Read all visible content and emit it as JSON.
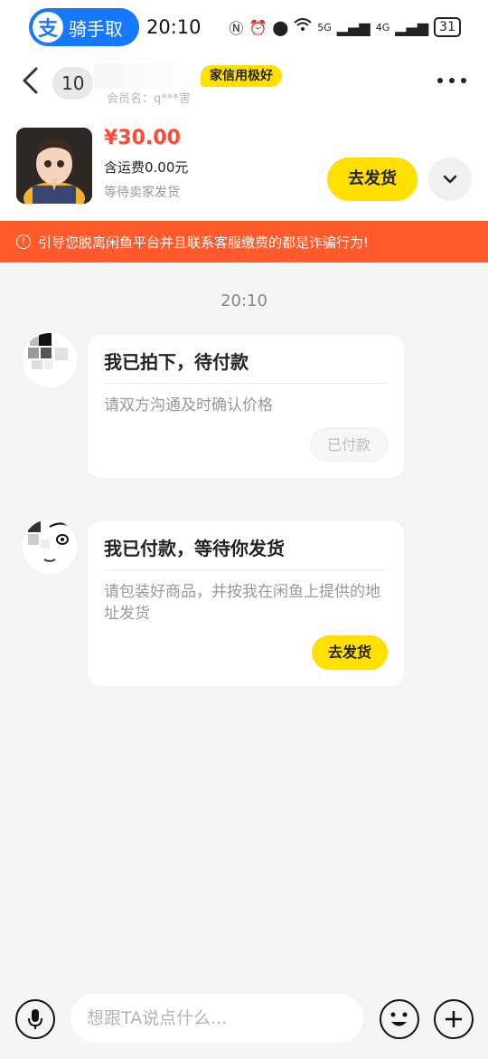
{
  "status_bar": {
    "app_pill_logo": "支",
    "app_pill_label": "骑手取",
    "time": "20:10",
    "network": "5G",
    "network2": "4G",
    "battery": "31"
  },
  "header": {
    "back_icon": "chevron-left-icon",
    "name_prefix": "10",
    "credit_badge": "家信用极好",
    "member_line": "会员名：q***害",
    "more_icon": "more-dots-icon"
  },
  "product": {
    "price": "¥30.00",
    "shipping": "含运费0.00元",
    "status": "等待卖家发货",
    "ship_button": "去发货"
  },
  "warning": {
    "text": "引导您脱离闲鱼平台并且联系客服缴费的都是诈骗行为!"
  },
  "chat": {
    "timestamp": "20:10",
    "messages": [
      {
        "title": "我已拍下，待付款",
        "desc": "请双方沟通及时确认价格",
        "button": "已付款"
      },
      {
        "title": "我已付款，等待你发货",
        "desc": "请包装好商品，并按我在闲鱼上提供的地址发货",
        "button": "去发货"
      }
    ]
  },
  "input_bar": {
    "placeholder": "想跟TA说点什么..."
  },
  "colors": {
    "brand_yellow": "#ffe000",
    "price_red": "#ff4b33",
    "warning_bg": "#ff5a2b",
    "alipay_blue": "#1677ff"
  }
}
